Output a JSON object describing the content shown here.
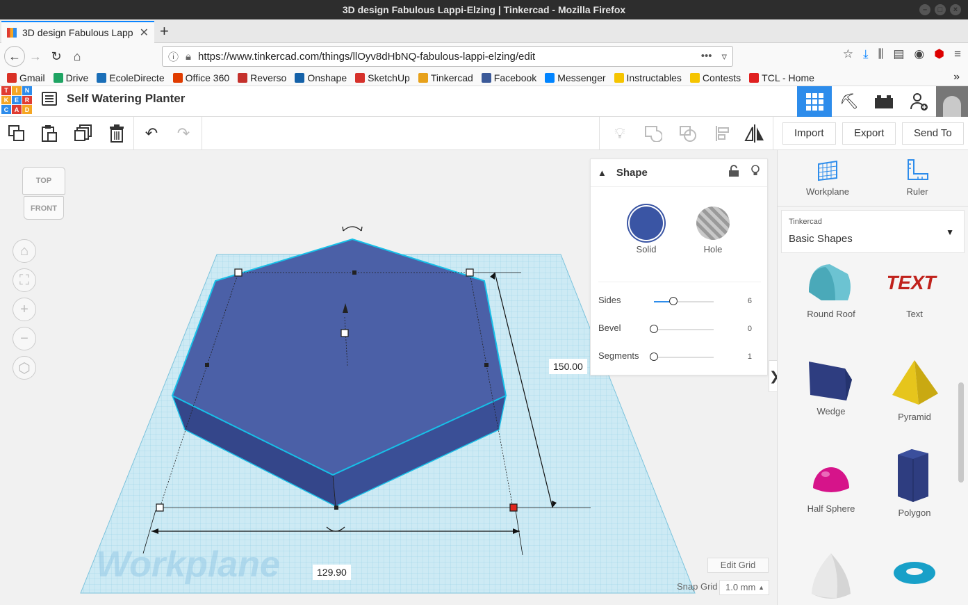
{
  "window": {
    "title": "3D design Fabulous Lappi-Elzing | Tinkercad - Mozilla Firefox"
  },
  "browser": {
    "tab_title": "3D design Fabulous Lapp",
    "url": "https://www.tinkercad.com/things/llOyv8dHbNQ-fabulous-lappi-elzing/edit",
    "bookmarks": [
      {
        "label": "Gmail",
        "color": "#d93025"
      },
      {
        "label": "Drive",
        "color": "#1fa463"
      },
      {
        "label": "EcoleDirecte",
        "color": "#1b6fb8"
      },
      {
        "label": "Office 360",
        "color": "#e03c00"
      },
      {
        "label": "Reverso",
        "color": "#c4302b"
      },
      {
        "label": "Onshape",
        "color": "#1461a8"
      },
      {
        "label": "SketchUp",
        "color": "#d6312b"
      },
      {
        "label": "Tinkercad",
        "color": "#e7a11b"
      },
      {
        "label": "Facebook",
        "color": "#3b5998"
      },
      {
        "label": "Messenger",
        "color": "#0084ff"
      },
      {
        "label": "Instructables",
        "color": "#f5c400"
      },
      {
        "label": "Contests",
        "color": "#f5c400"
      },
      {
        "label": "TCL - Home",
        "color": "#e02020"
      }
    ]
  },
  "app": {
    "logo_letters": [
      "T",
      "I",
      "N",
      "K",
      "E",
      "R",
      "C",
      "A",
      "D"
    ],
    "project_title": "Self Watering Planter"
  },
  "toolbar": {
    "import_label": "Import",
    "export_label": "Export",
    "sendto_label": "Send To"
  },
  "viewcube": {
    "top": "TOP",
    "front": "FRONT"
  },
  "workplane": {
    "label": "Workplane",
    "dim_width": "129.90",
    "dim_depth": "150.00",
    "edit_grid": "Edit Grid",
    "snap_grid_label": "Snap Grid",
    "snap_grid_value": "1.0 mm"
  },
  "inspector": {
    "title": "Shape",
    "solid_label": "Solid",
    "hole_label": "Hole",
    "solid_color": "#3a55a4",
    "props": [
      {
        "label": "Sides",
        "value": "6",
        "level": 0.33
      },
      {
        "label": "Bevel",
        "value": "0",
        "level": 0
      },
      {
        "label": "Segments",
        "value": "1",
        "level": 0
      }
    ]
  },
  "sidebar": {
    "workplane_label": "Workplane",
    "ruler_label": "Ruler",
    "library_small": "Tinkercad",
    "library_name": "Basic Shapes",
    "shapes": [
      {
        "label": "Round Roof",
        "icon": "round-roof-icon"
      },
      {
        "label": "Text",
        "icon": "text-icon"
      },
      {
        "label": "Wedge",
        "icon": "wedge-icon"
      },
      {
        "label": "Pyramid",
        "icon": "pyramid-icon"
      },
      {
        "label": "Half Sphere",
        "icon": "half-sphere-icon"
      },
      {
        "label": "Polygon",
        "icon": "polygon-icon"
      },
      {
        "label": "",
        "icon": "paraboloid-icon"
      },
      {
        "label": "",
        "icon": "torus-icon"
      }
    ]
  }
}
